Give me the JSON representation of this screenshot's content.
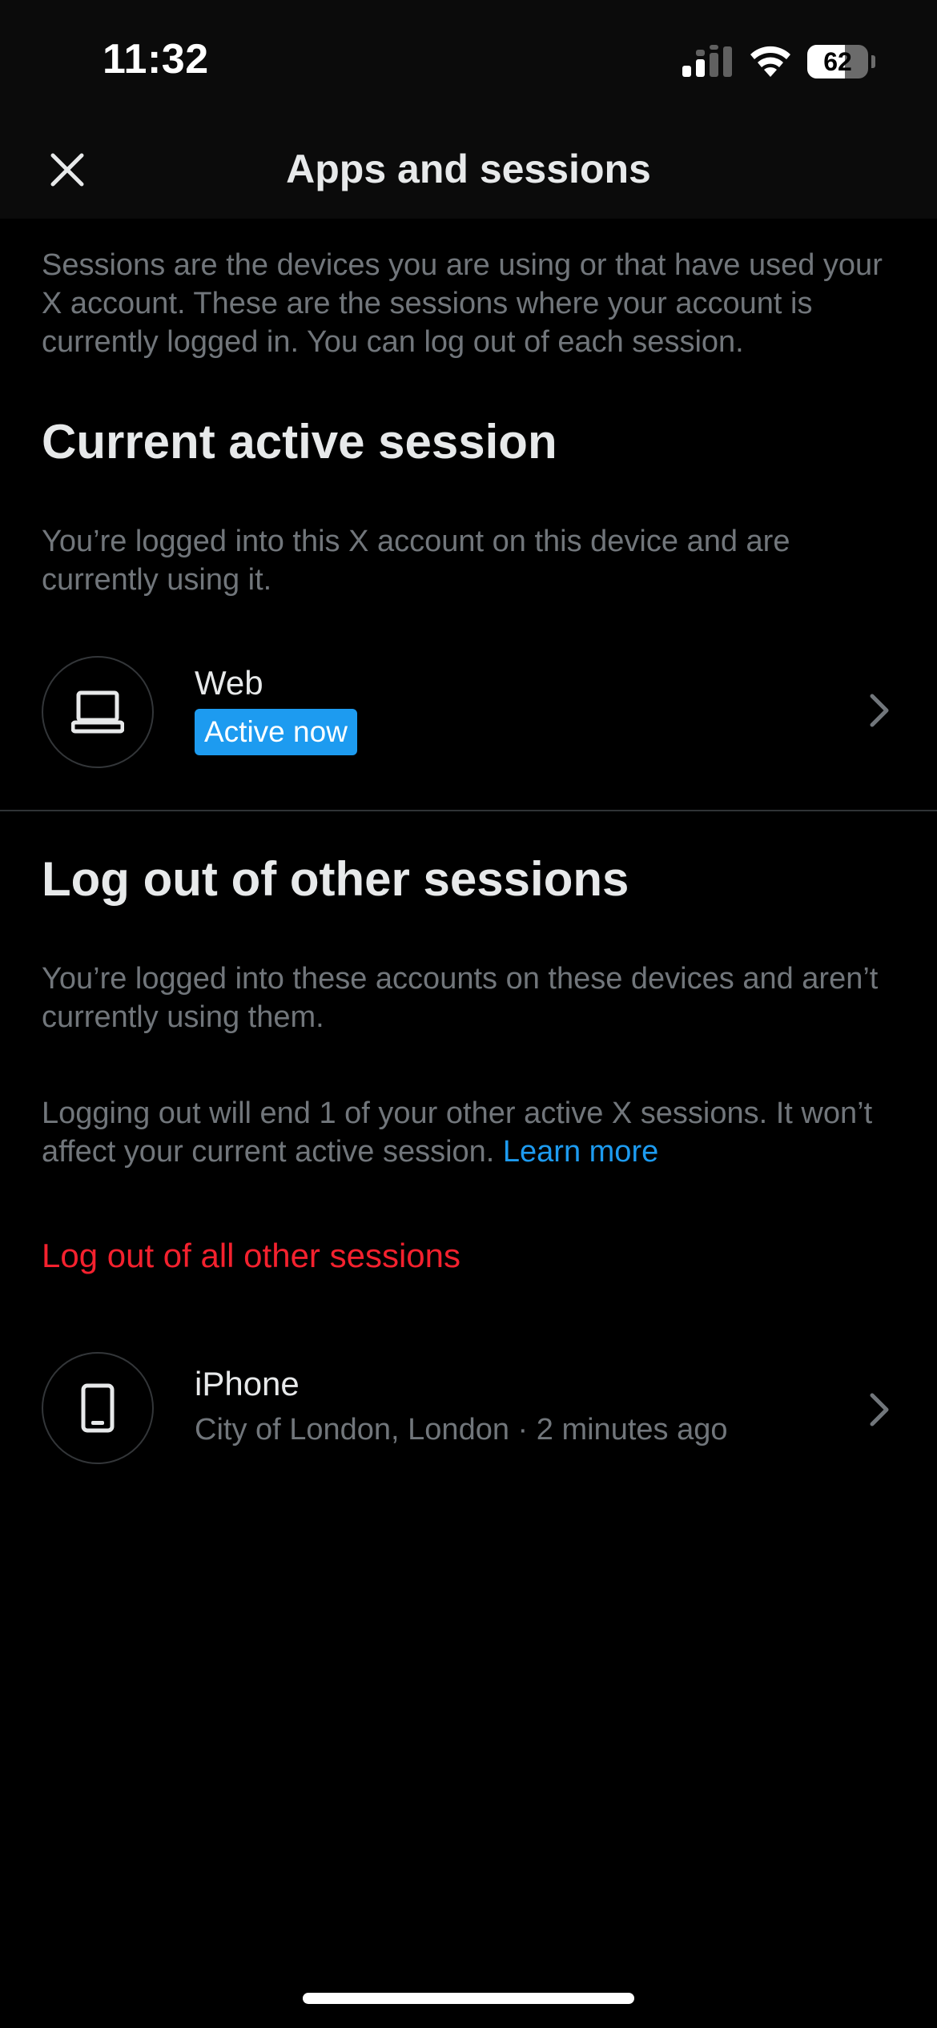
{
  "status_bar": {
    "time": "11:32",
    "battery_level": "62",
    "battery_fraction": 0.62,
    "signal_icon": "cellular-signal-icon",
    "wifi_icon": "wifi-icon"
  },
  "header": {
    "title": "Apps and sessions",
    "close_icon": "close-icon"
  },
  "intro": {
    "text": "Sessions are the devices you are using or that have used your X account. These are the sessions where your account is currently logged in. You can log out of each session."
  },
  "current_session": {
    "heading": "Current active session",
    "description": "You’re logged into this X account on this device and are currently using it.",
    "device_icon": "laptop-icon",
    "device_name": "Web",
    "badge": "Active now"
  },
  "other_sessions": {
    "heading": "Log out of other sessions",
    "description": "You’re logged into these accounts on these devices and aren’t currently using them.",
    "info_text": "Logging out will end 1 of your other active X sessions. It won’t affect your current active session.",
    "learn_more": "Learn more",
    "logout_all": "Log out of all other sessions",
    "sessions": [
      {
        "device_icon": "smartphone-icon",
        "device_name": "iPhone",
        "location": "City of London, London",
        "separator": "·",
        "last_active": "2 minutes ago"
      }
    ]
  },
  "colors": {
    "background": "#000000",
    "header_bg": "#0b0b0b",
    "primary_text": "#e7e9ea",
    "secondary_text": "#71767b",
    "accent": "#1d9bf0",
    "danger": "#f4212e",
    "divider": "#2f3336"
  }
}
